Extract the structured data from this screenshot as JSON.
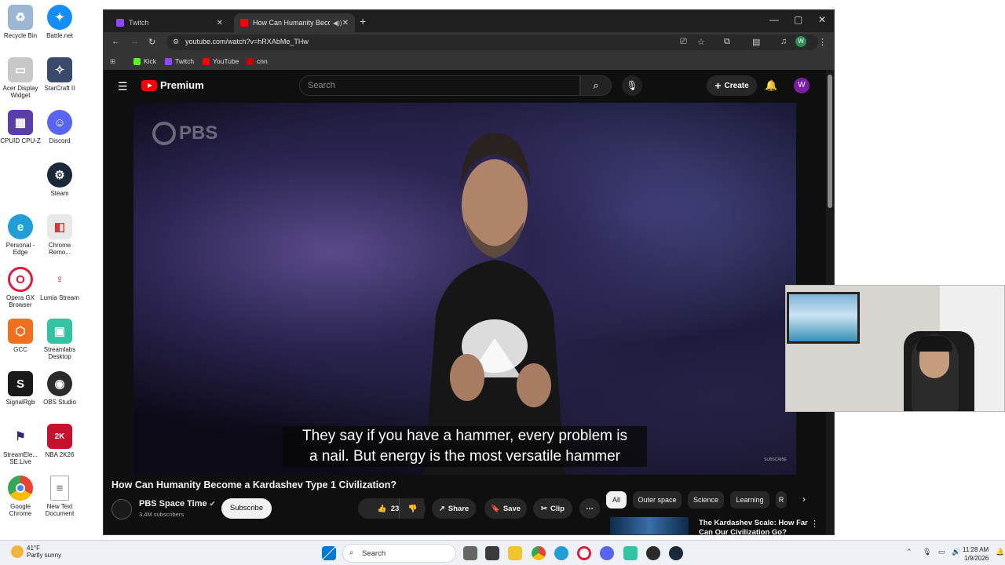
{
  "desktop": {
    "icons": [
      {
        "label": "Recycle Bin"
      },
      {
        "label": "Battle.net"
      },
      {
        "label": "Acer Display Widget"
      },
      {
        "label": "StarCraft II"
      },
      {
        "label": "CPUID CPU-Z"
      },
      {
        "label": "Discord"
      },
      {
        "label": "Steam"
      },
      {
        "label": "Personal - Edge"
      },
      {
        "label": "Chrome Remo..."
      },
      {
        "label": "Opera GX Browser"
      },
      {
        "label": "Lumia Stream"
      },
      {
        "label": "GCC"
      },
      {
        "label": "Streamlabs Desktop"
      },
      {
        "label": "SignalRgb"
      },
      {
        "label": "OBS Studio"
      },
      {
        "label": "StreamEle... SE.Live"
      },
      {
        "label": "NBA 2K26"
      },
      {
        "label": "Google Chrome"
      },
      {
        "label": "New Text Document"
      }
    ]
  },
  "browser": {
    "tabs": [
      {
        "title": "Twitch"
      },
      {
        "title": "How Can Humanity Becom"
      }
    ],
    "url": "youtube.com/watch?v=hRXAbMe_THw",
    "bookmarks": [
      "Kick",
      "Twitch",
      "YouTube",
      "cnn"
    ],
    "profile_initial": "W"
  },
  "youtube": {
    "logo_text": "Premium",
    "search_placeholder": "Search",
    "create_label": "Create",
    "avatar_initial": "W",
    "watermark": "PBS",
    "caption_line1": "They say if you have a hammer, every problem is",
    "caption_line2": "a nail. But energy is the most versatile hammer",
    "subscribe_watermark": "SUBSCRIBE",
    "video_title": "How Can Humanity Become a Kardashev Type 1 Civilization?",
    "channel_name": "PBS Space Time",
    "subscribers": "3.4M subscribers",
    "subscribe_label": "Subscribe",
    "like_count": "23K",
    "share_label": "Share",
    "save_label": "Save",
    "clip_label": "Clip",
    "chips": [
      "All",
      "Outer space",
      "Science",
      "Learning",
      "R"
    ],
    "rec_title": "The Kardashev Scale: How Far Can Our Civilization Go?"
  },
  "taskbar": {
    "weather_temp": "41°F",
    "weather_desc": "Partly sunny",
    "search_label": "Search",
    "time": "11:28 AM",
    "date": "1/9/2026"
  },
  "colors": {
    "youtube_red": "#ff0000",
    "twitch_purple": "#9146ff",
    "kick_green": "#53fc18",
    "avatar_purple": "#7b1fa2"
  }
}
